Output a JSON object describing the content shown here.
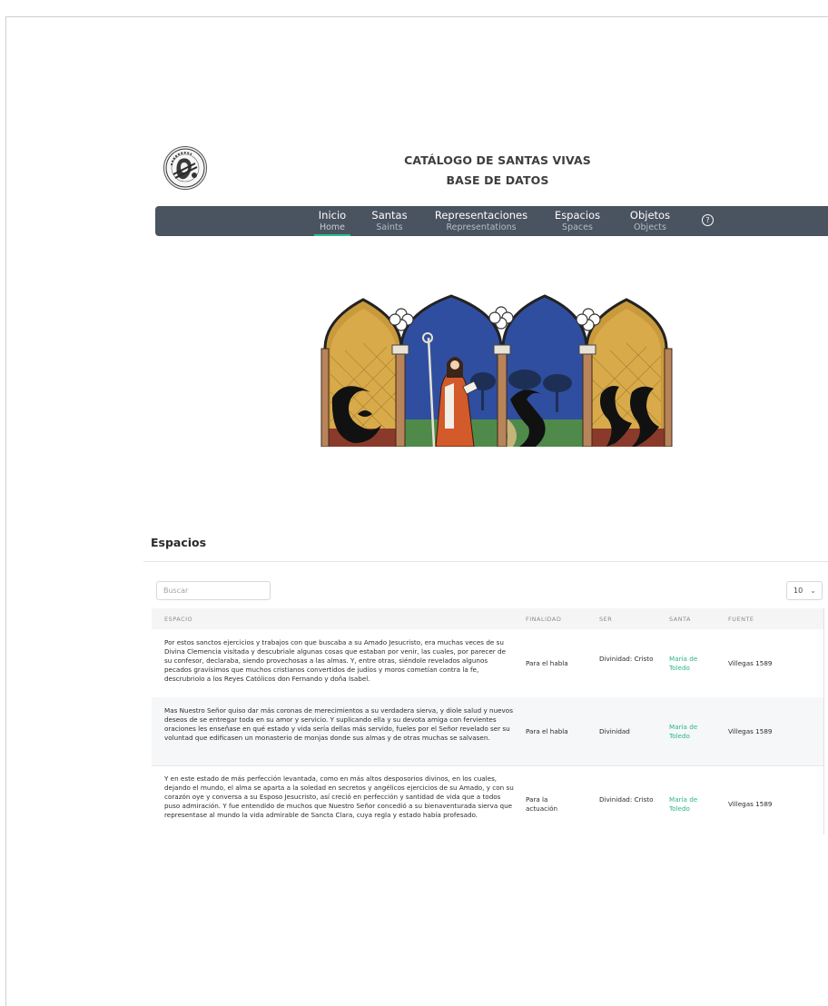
{
  "header": {
    "title_line1": "CATÁLOGO DE SANTAS VIVAS",
    "title_line2": "BASE DE DATOS",
    "logo_icon": "base-de-datos-seal-logo"
  },
  "nav": {
    "items": [
      {
        "label": "Inicio",
        "sublabel": "Home",
        "active": true
      },
      {
        "label": "Santas",
        "sublabel": "Saints"
      },
      {
        "label": "Representaciones",
        "sublabel": "Representations"
      },
      {
        "label": "Espacios",
        "sublabel": "Spaces"
      },
      {
        "label": "Objetos",
        "sublabel": "Objects"
      }
    ],
    "help_icon": "question-circle-icon",
    "help_glyph": "?",
    "bg_color": "#4a5360",
    "accent_color": "#2bbf8a"
  },
  "section": {
    "title": "Espacios",
    "search_placeholder": "Buscar",
    "page_size": "10",
    "page_size_icon": "chevron-down-icon",
    "chevron_glyph": "⌄"
  },
  "table": {
    "columns": [
      "ESPACIO",
      "FINALIDAD",
      "SER",
      "SANTA",
      "FUENTE"
    ],
    "rows": [
      {
        "espacio": "Por estos sanctos ejercicios y trabajos con que buscaba a su Amado Jesucristo, era muchas veces de su Divina Clemencia visitada y descubriale algunas cosas que estaban por venir, las cuales, por parecer de su confesor, declaraba, siendo provechosas a las almas. Y, entre otras, siéndole revelados algunos pecados gravísimos que muchos cristianos convertidos de judíos y moros cometían contra la fe, descrubriolo a los Reyes Católicos don Fernando y doña Isabel.",
        "finalidad": "Para el habla",
        "ser": "Divinidad: Cristo",
        "santa": "María de Toledo",
        "fuente": "Villegas 1589"
      },
      {
        "espacio": "Mas Nuestro Señor quiso dar más coronas de merecimientos a su verdadera sierva, y diole salud y nuevos deseos de se entregar toda en su amor y servicio. Y suplicando ella y su devota amiga con fervientes oraciones les enseñase en qué estado y vida sería dellas más servido, fueles por el Señor revelado ser su voluntad que edificasen un monasterio de monjas donde sus almas y de otras muchas se salvasen.",
        "finalidad": "Para el habla",
        "ser": "Divinidad",
        "santa": "María de Toledo",
        "fuente": "Villegas 1589"
      },
      {
        "espacio": "Y en este estado de más perfección levantada, como en más altos desposorios divinos, en los cuales, dejando el mundo, el alma se aparta a la soledad en secretos y angélicos ejercicios de su Amado, y con su corazón oye y conversa a su Esposo Jesucristo, así creció en perfección y santidad de vida que a todos puso admiración. Y fue entendido de muchos que Nuestro Señor concedió a su bienaventurada sierva que representase al mundo la vida admirable de Sancta Clara, cuya regla y estado había profesado.",
        "finalidad": "Para la actuación",
        "ser": "Divinidad: Cristo",
        "santa": "María de Toledo",
        "fuente": "Villegas 1589"
      }
    ]
  },
  "colors": {
    "santa_link": "#2bb583",
    "row_alt": "#f6f7f8",
    "header_bg": "#f5f5f5"
  }
}
